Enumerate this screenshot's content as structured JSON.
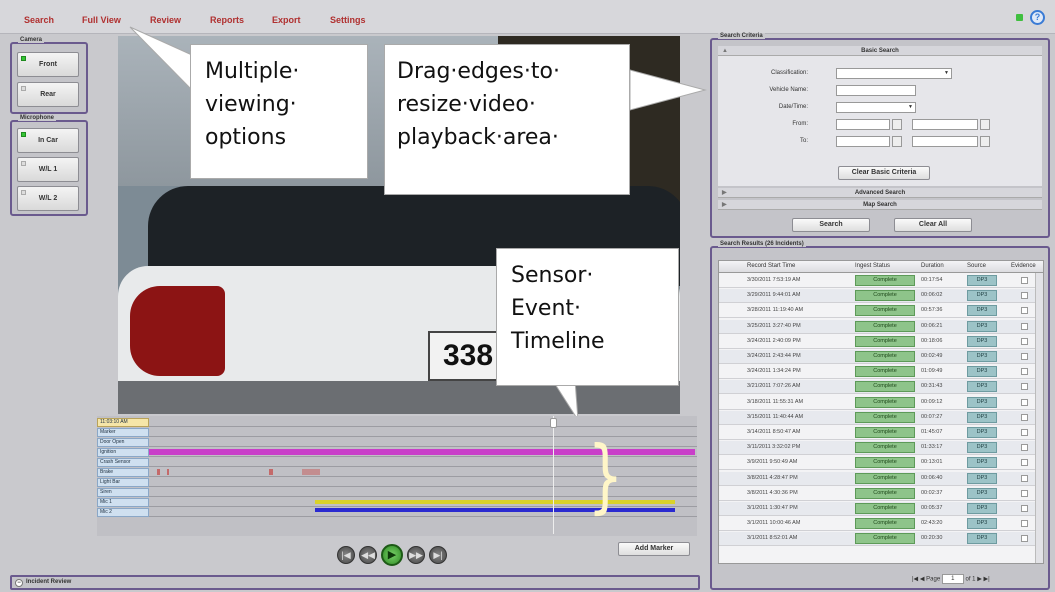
{
  "nav": {
    "items": [
      "Search",
      "Full View",
      "Review",
      "Reports",
      "Export",
      "Settings"
    ],
    "help_icon": "?"
  },
  "camera_panel": {
    "legend": "Camera",
    "buttons": [
      {
        "label": "Front",
        "active": true
      },
      {
        "label": "Rear",
        "active": false
      }
    ]
  },
  "microphone_panel": {
    "legend": "Microphone",
    "buttons": [
      {
        "label": "In Car",
        "active": true
      },
      {
        "label": "W/L 1",
        "active": false
      },
      {
        "label": "W/L 2",
        "active": false
      }
    ]
  },
  "video": {
    "plate_text": "338"
  },
  "callouts": {
    "multiple_viewing": [
      "Multiple·",
      "viewing·",
      "options"
    ],
    "drag_edges": [
      "Drag·edges·to·",
      "resize·video·",
      "playback·area·"
    ],
    "sensor_event": [
      "Sensor·",
      "Event·",
      "Timeline"
    ]
  },
  "timeline": {
    "rows": [
      {
        "label": "11:03:10 AM",
        "type": "time"
      },
      {
        "label": "Marker"
      },
      {
        "label": "Door Open"
      },
      {
        "label": "Ignition"
      },
      {
        "label": "Crash Sensor"
      },
      {
        "label": "Brake"
      },
      {
        "label": "Light Bar"
      },
      {
        "label": "Siren"
      },
      {
        "label": "Mic 1"
      },
      {
        "label": "Mic 2"
      }
    ],
    "colors": {
      "ignition": "#c93fc9",
      "mic1": "#d9d22a",
      "mic2": "#2a2ad0",
      "brake": "#c46a6a"
    }
  },
  "controls": {
    "add_marker": "Add Marker",
    "rewind_icon": "skip-back-icon",
    "prev_icon": "step-back-icon",
    "play_icon": "play-icon",
    "next_icon": "step-forward-icon",
    "ff_icon": "skip-forward-icon"
  },
  "incident_review": {
    "label": "Incident Review"
  },
  "search_criteria": {
    "legend": "Search Criteria",
    "basic_search": "Basic Search",
    "fields": {
      "classification": "Classification:",
      "vehicle_name": "Vehicle Name:",
      "date_time": "Date/Time:",
      "from": "From:",
      "to": "To:"
    },
    "clear_basic": "Clear Basic Criteria",
    "advanced_search": "Advanced Search",
    "map_search": "Map Search",
    "search_btn": "Search",
    "clear_all_btn": "Clear All"
  },
  "results": {
    "legend": "Search Results (26 Incidents)",
    "columns": [
      "Record Start Time",
      "Ingest Status",
      "Duration",
      "Source",
      "Evidence"
    ],
    "rows": [
      {
        "time": "3/30/2011 7:53:19 AM",
        "status": "Complete",
        "duration": "00:17:54",
        "source": "DP3"
      },
      {
        "time": "3/29/2011 9:44:01 AM",
        "status": "Complete",
        "duration": "00:06:02",
        "source": "DP3"
      },
      {
        "time": "3/28/2011 11:19:40 AM",
        "status": "Complete",
        "duration": "00:57:36",
        "source": "DP3"
      },
      {
        "time": "3/25/2011 3:27:40 PM",
        "status": "Complete",
        "duration": "00:06:21",
        "source": "DP3"
      },
      {
        "time": "3/24/2011 2:40:09 PM",
        "status": "Complete",
        "duration": "00:18:06",
        "source": "DP3"
      },
      {
        "time": "3/24/2011 2:43:44 PM",
        "status": "Complete",
        "duration": "00:02:49",
        "source": "DP3"
      },
      {
        "time": "3/24/2011 1:34:24 PM",
        "status": "Complete",
        "duration": "01:09:49",
        "source": "DP3"
      },
      {
        "time": "3/21/2011 7:07:26 AM",
        "status": "Complete",
        "duration": "00:31:43",
        "source": "DP3"
      },
      {
        "time": "3/18/2011 11:55:31 AM",
        "status": "Complete",
        "duration": "00:09:12",
        "source": "DP3"
      },
      {
        "time": "3/15/2011 11:40:44 AM",
        "status": "Complete",
        "duration": "00:07:27",
        "source": "DP3"
      },
      {
        "time": "3/14/2011 8:50:47 AM",
        "status": "Complete",
        "duration": "01:45:07",
        "source": "DP3"
      },
      {
        "time": "3/11/2011 3:32:02 PM",
        "status": "Complete",
        "duration": "01:33:17",
        "source": "DP3"
      },
      {
        "time": "3/9/2011 9:50:49 AM",
        "status": "Complete",
        "duration": "00:13:01",
        "source": "DP3"
      },
      {
        "time": "3/8/2011 4:28:47 PM",
        "status": "Complete",
        "duration": "00:06:40",
        "source": "DP3"
      },
      {
        "time": "3/8/2011 4:30:36 PM",
        "status": "Complete",
        "duration": "00:02:37",
        "source": "DP3"
      },
      {
        "time": "3/1/2011 1:30:47 PM",
        "status": "Complete",
        "duration": "00:05:37",
        "source": "DP3"
      },
      {
        "time": "3/1/2011 10:00:46 AM",
        "status": "Complete",
        "duration": "02:43:20",
        "source": "DP3"
      },
      {
        "time": "3/1/2011 8:52:01 AM",
        "status": "Complete",
        "duration": "00:20:30",
        "source": "DP3"
      }
    ],
    "pager": {
      "page_label": "Page",
      "page_value": "1",
      "of_label": "of 1"
    }
  }
}
